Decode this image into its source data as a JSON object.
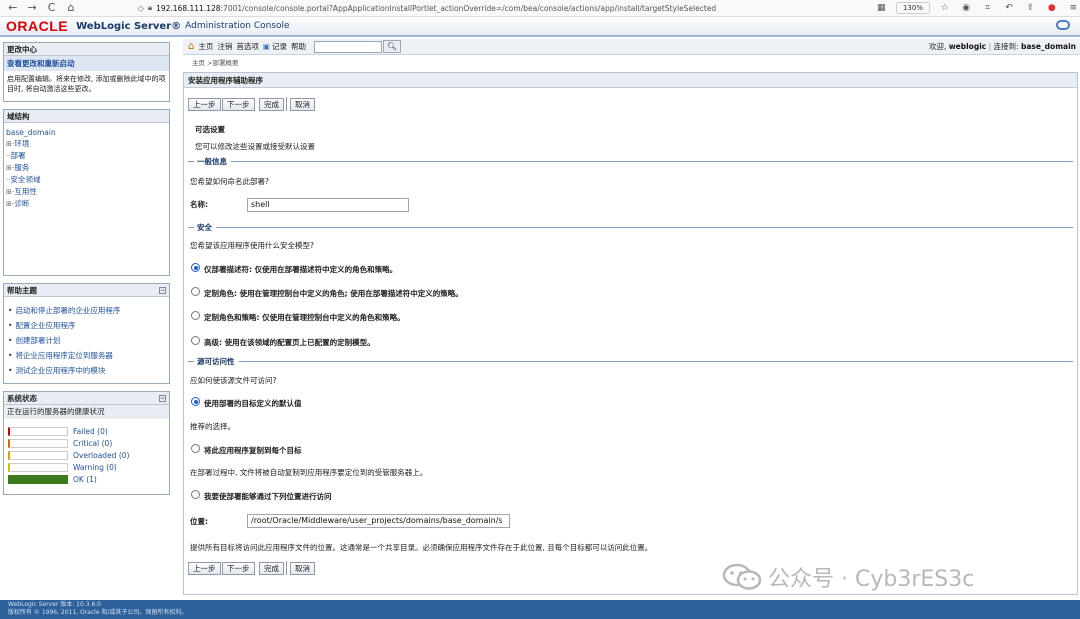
{
  "browser": {
    "back": "←",
    "forward": "→",
    "reload": "C",
    "home": "⌂",
    "url_host": "192.168.111.128",
    "url_rest": ":7001/console/console.portal?AppApplicationInstallPortlet_actionOverride=/com/bea/console/actions/app/install/targetStyleSelected",
    "zoom": "130%"
  },
  "header": {
    "logo": "ORACLE",
    "product": "WebLogic Server®",
    "console": "Administration Console"
  },
  "change_center": {
    "title": "更改中心",
    "link": "查看更改和重新启动",
    "description": "启用配置编辑。将来在修改, 添加或删除此域中的项目时, 将自动激活这些更改。"
  },
  "domain_structure": {
    "title": "域结构",
    "root": "base_domain",
    "items": [
      {
        "prefix": "⊞-",
        "label": "环境"
      },
      {
        "prefix": "··",
        "label": "部署"
      },
      {
        "prefix": "⊞-",
        "label": "服务"
      },
      {
        "prefix": "··",
        "label": "安全领域"
      },
      {
        "prefix": "⊞-",
        "label": "互用性"
      },
      {
        "prefix": "⊞-",
        "label": "诊断"
      }
    ]
  },
  "help_topics": {
    "title": "帮助主题",
    "items": [
      "启动和停止部署的企业应用程序",
      "配置企业应用程序",
      "创建部署计划",
      "将企业应用程序定位到服务器",
      "测试企业应用程序中的模块"
    ]
  },
  "system_status": {
    "title": "系统状态",
    "subtitle": "正在运行的服务器的健康状况",
    "rows": [
      {
        "label": "Failed (0)",
        "fill": 0,
        "color": "#cc0000"
      },
      {
        "label": "Critical (0)",
        "fill": 0,
        "color": "#e06000"
      },
      {
        "label": "Overloaded (0)",
        "fill": 0,
        "color": "#e0a000"
      },
      {
        "label": "Warning (0)",
        "fill": 0,
        "color": "#d0c000"
      },
      {
        "label": "OK (1)",
        "fill": 1,
        "color": "#3d7a1e"
      }
    ]
  },
  "toolbar": {
    "home": "主页",
    "logout": "注销",
    "preferences": "首选项",
    "record": "记录",
    "help": "帮助",
    "search_value": "",
    "welcome_prefix": "欢迎,",
    "user": "weblogic",
    "connected_prefix": "连接到:",
    "domain": "base_domain"
  },
  "breadcrumb": "主页 >部署概要",
  "wizard": {
    "title": "安装应用程序辅助程序",
    "buttons": {
      "back": "上一步",
      "next": "下一步",
      "finish": "完成",
      "cancel": "取消"
    },
    "optional_title": "可选设置",
    "optional_desc": "您可以修改这些设置或接受默认设置",
    "general": {
      "section": "一般信息",
      "question": "您希望如何命名此部署?",
      "name_label": "名称:",
      "name_value": "shell"
    },
    "security": {
      "section": "安全",
      "question": "您希望该应用程序使用什么安全模型?",
      "options": [
        {
          "label": "仅部署描述符: 仅使用在部署描述符中定义的角色和策略。",
          "selected": true
        },
        {
          "label": "定制角色: 使用在管理控制台中定义的角色; 使用在部署描述符中定义的策略。",
          "selected": false
        },
        {
          "label": "定制角色和策略: 仅使用在管理控制台中定义的角色和策略。",
          "selected": false
        },
        {
          "label": "高级: 使用在该领域的配置页上已配置的定制模型。",
          "selected": false
        }
      ]
    },
    "source": {
      "section": "源可访问性",
      "question": "应如何使该源文件可访问?",
      "option1": "使用部署的目标定义的默认值",
      "option1_note": "推荐的选择。",
      "option2": "将此应用程序复制到每个目标",
      "option2_note": "在部署过程中, 文件将被自动复制到应用程序要定位到的受管服务器上。",
      "option3": "我要使部署能够通过下列位置进行访问",
      "location_label": "位置:",
      "location_value": "/root/Oracle/Middleware/user_projects/domains/base_domain/s",
      "location_note": "提供所有目标将访问此应用程序文件的位置。这通常是一个共享目录。必须确保应用程序文件存在于此位置, 且每个目标都可以访问此位置。"
    }
  },
  "footer": {
    "line1": "WebLogic Server 版本: 10.3.6.0",
    "line2": "版权所有 © 1996, 2011, Oracle 和/或其子公司。保留所有权利。"
  },
  "watermark": "公众号 · Cyb3rES3c"
}
